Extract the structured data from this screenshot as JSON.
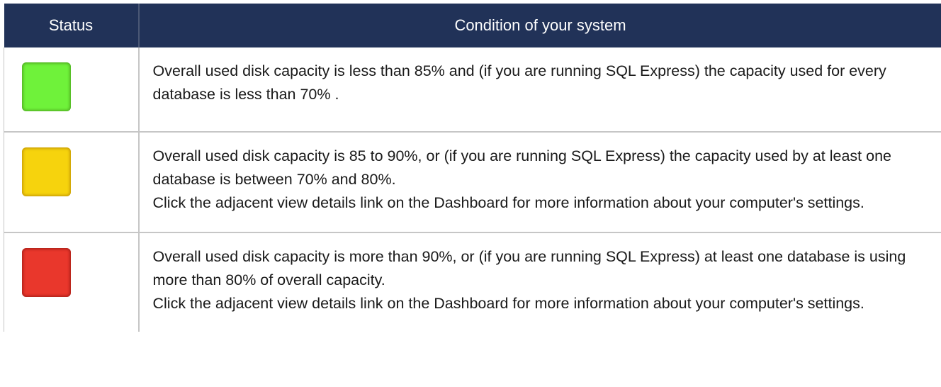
{
  "table": {
    "headers": {
      "status": "Status",
      "condition": "Condition of your system"
    },
    "rows": [
      {
        "status_color": "#6ff23a",
        "status_icon": "green-status-square",
        "paragraphs": [
          "Overall used disk capacity is less than 85% and (if you are running SQL Express) the capacity used for every database is less than 70% ."
        ]
      },
      {
        "status_color": "#f6d30d",
        "status_icon": "yellow-status-square",
        "paragraphs": [
          "Overall used disk capacity is 85 to 90%, or (if you are running SQL Express) the capacity used by at least one database is between 70% and 80%.",
          "Click the adjacent view details link on the Dashboard for more information about your computer's settings."
        ]
      },
      {
        "status_color": "#e9372c",
        "status_icon": "red-status-square",
        "paragraphs": [
          "Overall used disk capacity is more than 90%, or (if you are running SQL Express) at least one database is using more than 80% of overall capacity.",
          "Click the adjacent view details link on the Dashboard for more information about your computer's settings."
        ]
      }
    ]
  }
}
